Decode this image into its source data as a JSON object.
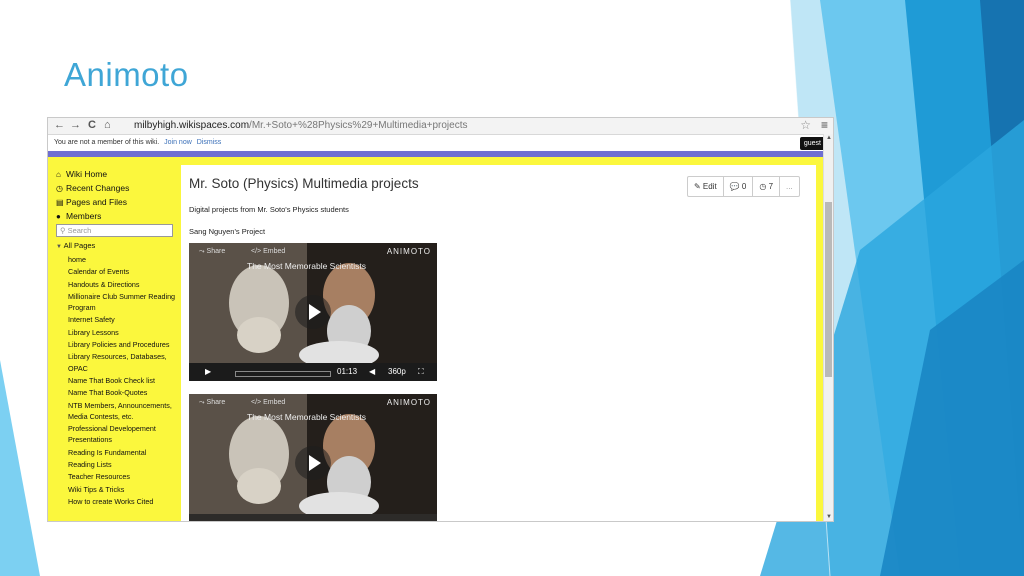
{
  "slide": {
    "title": "Animoto"
  },
  "browser": {
    "url_domain": "milbyhigh.wikispaces.com",
    "url_path": "/Mr.+Soto+%28Physics%29+Multimedia+projects",
    "back_icon": "←",
    "forward_icon": "→",
    "reload_icon": "C",
    "home_icon": "⌂",
    "star_icon": "☆",
    "menu_icon": "≡"
  },
  "notice": {
    "text": "You are not a member of this wiki.",
    "join": "Join now",
    "dismiss": "Dismiss",
    "user": "guest"
  },
  "sidebar": {
    "top": [
      {
        "icon": "⌂",
        "label": "Wiki Home"
      },
      {
        "icon": "◷",
        "label": "Recent Changes"
      },
      {
        "icon": "▤",
        "label": "Pages and Files"
      },
      {
        "icon": "●",
        "label": "Members"
      }
    ],
    "search_placeholder": "Search",
    "all_pages": "All Pages",
    "pages": [
      "home",
      "Calendar of Events",
      "Handouts & Directions",
      "Millionaire Club Summer Reading Program",
      "Internet Safety",
      "Library Lessons",
      "Library Policies and Procedures",
      "Library Resources, Databases, OPAC",
      "Name That Book Check list",
      "Name That Book-Quotes",
      "NTB Members, Announcements, Media Contests, etc.",
      "Professional Developement Presentations",
      "Reading Is Fundamental",
      "Reading Lists",
      "Teacher Resources",
      "Wiki Tips & Tricks",
      "How to create Works Cited"
    ]
  },
  "main": {
    "title": "Mr. Soto (Physics) Multimedia projects",
    "toolbar": {
      "edit": "✎ Edit",
      "comments": "💬 0",
      "history": "◷ 7",
      "more": "..."
    },
    "description": "Digital projects from Mr. Soto's Physics students",
    "project": "Sang Nguyen's Project",
    "video": {
      "share": "⤳ Share",
      "embed": "</> Embed",
      "brand": "ANIMOTO",
      "title": "The Most Memorable Scientists",
      "play_icon": "▶",
      "time": "01:13",
      "volume_icon": "◀",
      "quality": "360p",
      "fullscreen_icon": "⛶",
      "progress": 0.02
    }
  }
}
